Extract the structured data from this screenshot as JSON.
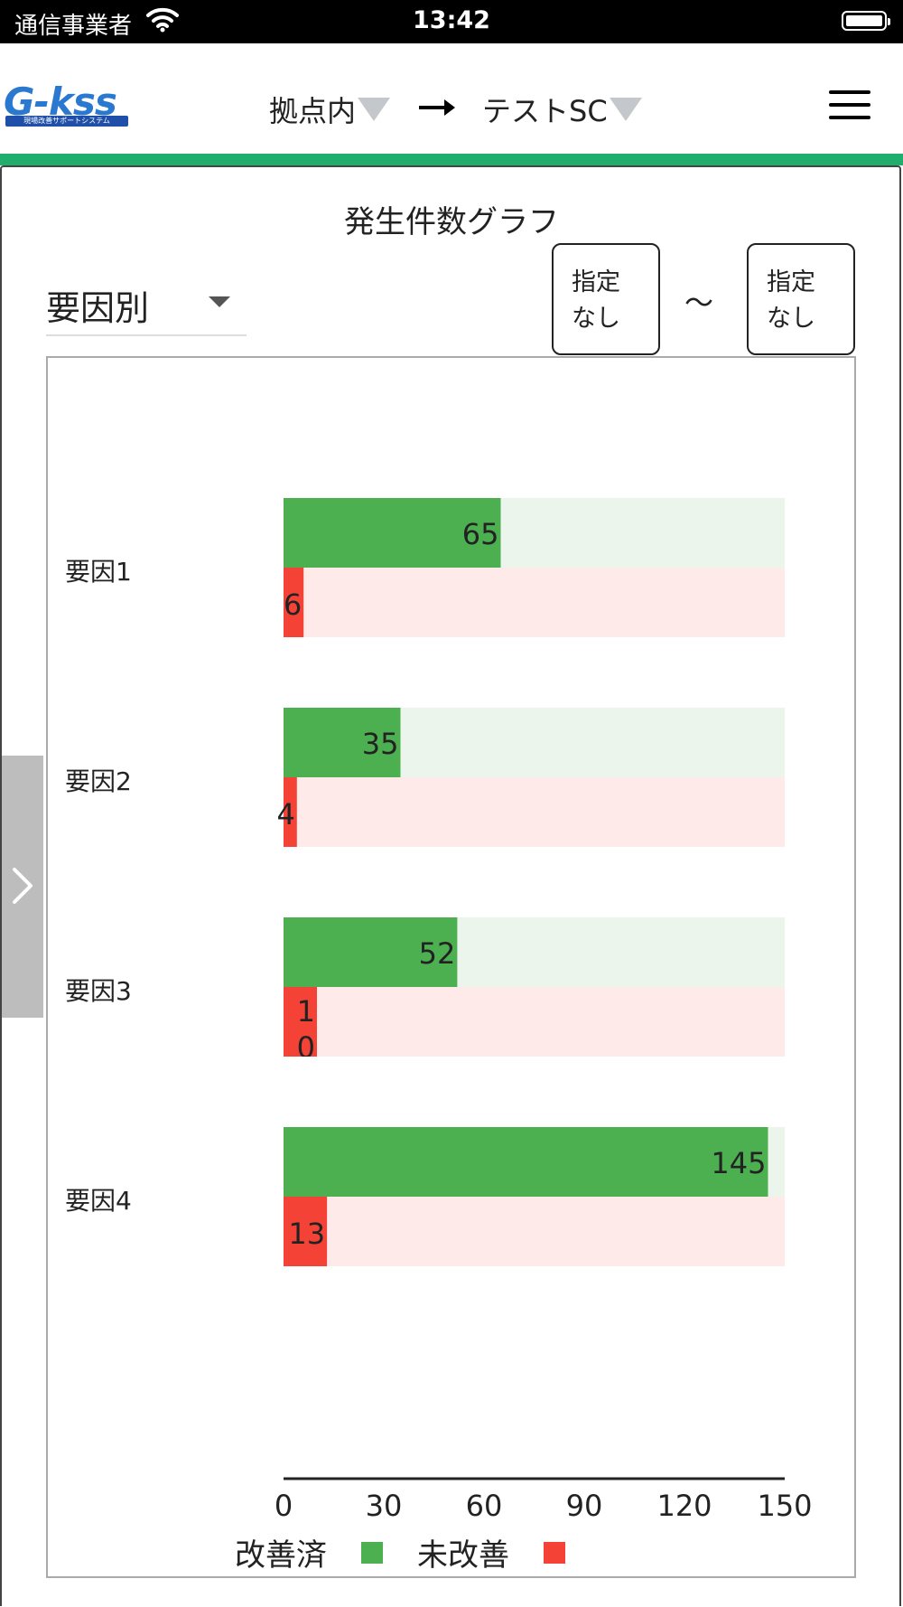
{
  "status_bar": {
    "carrier": "通信事業者",
    "time": "13:42"
  },
  "header": {
    "logo_text": "G-kss",
    "logo_subtitle": "現場改善サポートシステム",
    "from_site": "拠点内",
    "to_site": "テストSC"
  },
  "page": {
    "title": "発生件数グラフ",
    "grouping_select": "要因別",
    "date_from": "指定\nなし",
    "date_to": "指定\nなし",
    "date_separator": "〜"
  },
  "legend": {
    "improved_label": "改善済",
    "unimproved_label": "未改善"
  },
  "colors": {
    "improved": "#4caf50",
    "improved_bg": "#ebf5eb",
    "unimproved": "#f44336",
    "unimproved_bg": "#fdeae9",
    "accent_line": "#1fae6b"
  },
  "chart_data": {
    "type": "bar",
    "orientation": "horizontal",
    "categories": [
      "要因1",
      "要因2",
      "要因3",
      "要因4"
    ],
    "series": [
      {
        "name": "改善済",
        "values": [
          65,
          35,
          52,
          145
        ]
      },
      {
        "name": "未改善",
        "values": [
          6,
          4,
          10,
          13
        ]
      }
    ],
    "value_labels": {
      "improved": [
        "65",
        "35",
        "52",
        "145"
      ],
      "unimproved": [
        "6",
        "4",
        "1\n0",
        "13"
      ]
    },
    "x_ticks": [
      "0",
      "30",
      "60",
      "90",
      "120",
      "150"
    ],
    "xlim": [
      0,
      150
    ],
    "legend_position": "bottom",
    "grid": false
  }
}
